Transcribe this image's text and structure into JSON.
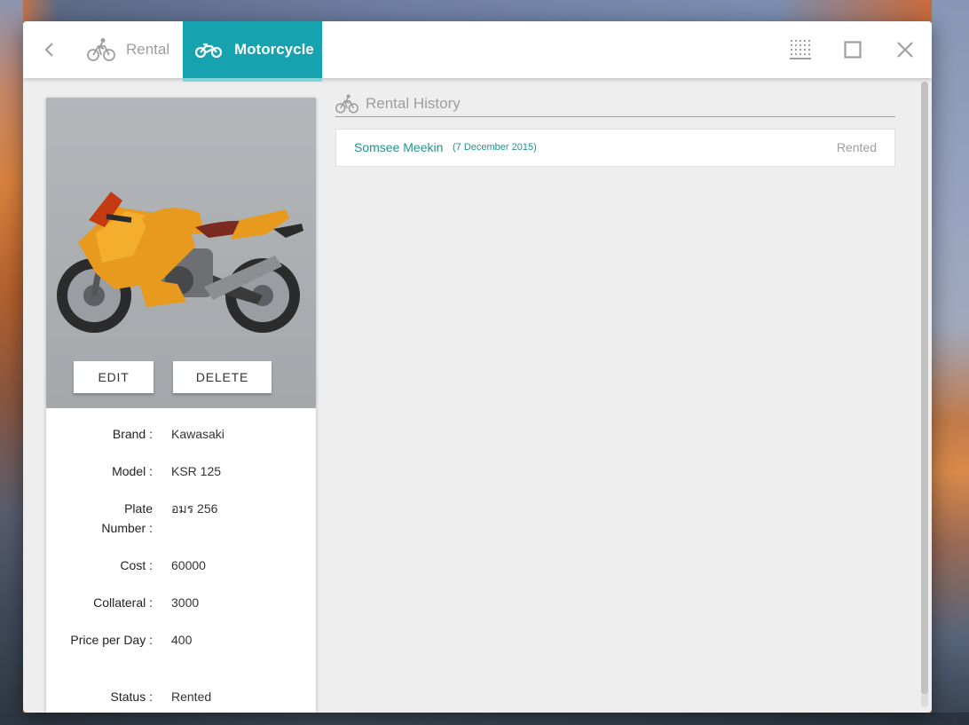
{
  "nav": {
    "back_icon": "chevron-left-icon",
    "tabs": [
      {
        "label": "Rental",
        "icon": "bicycle-rider-icon"
      },
      {
        "label": "Motorcycle",
        "icon": "motorcycle-icon"
      }
    ],
    "controls": [
      "grid-icon",
      "maximize-icon",
      "close-icon"
    ],
    "accent_color": "#16a2ae"
  },
  "vehicle": {
    "image": "orange-sport-motorcycle",
    "buttons": {
      "edit": "EDIT",
      "delete": "DELETE"
    },
    "fields": [
      {
        "label": "Brand :",
        "value": "Kawasaki"
      },
      {
        "label": "Model :",
        "value": "KSR 125"
      },
      {
        "label": "Plate Number :",
        "value": "อมร 256"
      },
      {
        "label": "Cost :",
        "value": "60000"
      },
      {
        "label": "Collateral :",
        "value": "3000"
      },
      {
        "label": "Price per Day :",
        "value": "400"
      },
      {
        "label": "Status :",
        "value": "Rented"
      }
    ]
  },
  "history": {
    "title": "Rental History",
    "icon": "bicycle-rider-icon",
    "items": [
      {
        "name": "Somsee Meekin",
        "date": "(7 December 2015)",
        "status": "Rented"
      }
    ]
  }
}
